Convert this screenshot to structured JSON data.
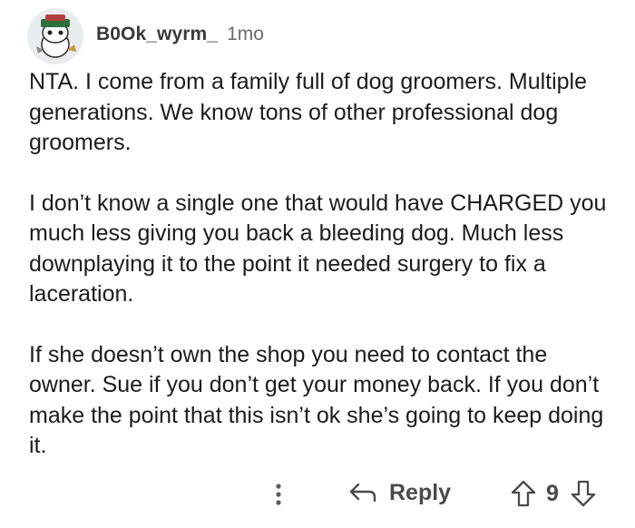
{
  "comment": {
    "author": "B0Ok_wyrm_",
    "age": "1mo",
    "avatar_icon": "snoo-avatar-icon",
    "paragraphs": [
      "NTA. I come from a family full of dog groomers. Multiple generations. We know tons of other professional dog groomers.",
      "I don’t know a single one that would have CHARGED you much less giving you back a bleeding dog. Much less downplaying it to the point it needed surgery to fix a laceration.",
      "If she doesn’t own the shop you need to contact the owner. Sue if you don’t get your money back. If you don’t make the point that this isn’t ok she’s going to keep doing it."
    ]
  },
  "actions": {
    "more_icon": "more-options-icon",
    "reply_icon": "reply-arrow-icon",
    "reply_label": "Reply",
    "upvote_icon": "upvote-arrow-icon",
    "vote_count": "9",
    "downvote_icon": "downvote-arrow-icon"
  },
  "colors": {
    "text": "#1c1c1c",
    "username": "#3a3a3a",
    "muted": "#6b6b6b",
    "action": "#4a4a4a"
  }
}
